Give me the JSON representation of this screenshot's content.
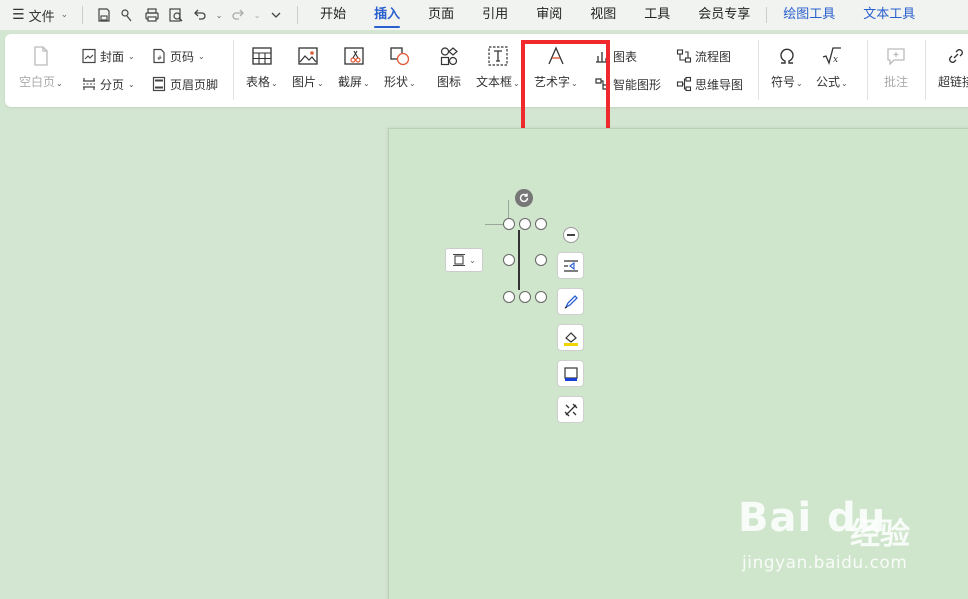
{
  "menubar": {
    "file_label": "文件",
    "tabs": [
      {
        "label": "开始"
      },
      {
        "label": "插入"
      },
      {
        "label": "页面"
      },
      {
        "label": "引用"
      },
      {
        "label": "审阅"
      },
      {
        "label": "视图"
      },
      {
        "label": "工具"
      },
      {
        "label": "会员专享"
      },
      {
        "label": "绘图工具"
      },
      {
        "label": "文本工具"
      }
    ],
    "active_tab": "插入"
  },
  "ribbon": {
    "blank_page": "空白页",
    "cover": "封面",
    "page_break": "分页",
    "page_number": "页码",
    "header_footer": "页眉页脚",
    "table": "表格",
    "picture": "图片",
    "screenshot": "截屏",
    "shape": "形状",
    "icon": "图标",
    "textbox": "文本框",
    "wordart": "艺术字",
    "chart": "图表",
    "smart_graphic": "智能图形",
    "flowchart": "流程图",
    "mindmap": "思维导图",
    "symbol": "符号",
    "formula": "公式",
    "comment": "批注",
    "hyperlink": "超链接"
  },
  "watermark": {
    "logo": "Bai du",
    "cn": "经验",
    "url": "jingyan.baidu.com"
  },
  "colors": {
    "accent": "#2a5fcf",
    "highlight": "#f0292c",
    "background": "#d3e6d1"
  }
}
